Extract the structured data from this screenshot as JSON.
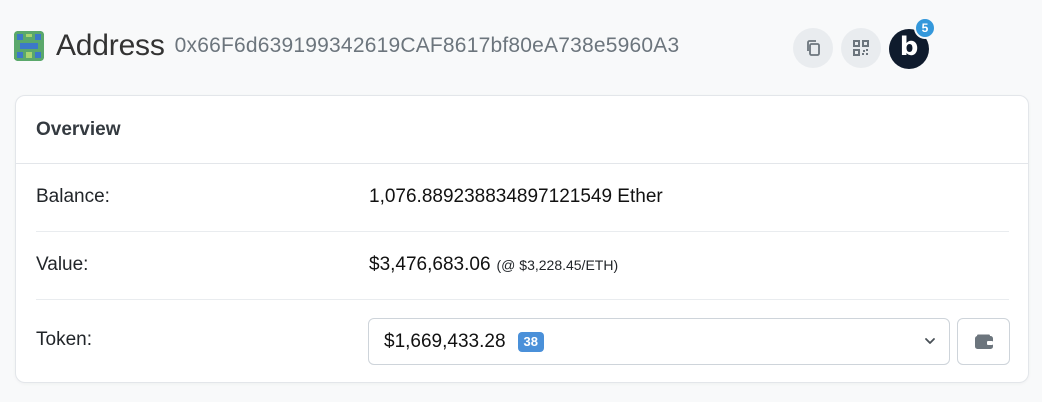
{
  "header": {
    "title": "Address",
    "address": "0x66F6d639199342619CAF8617bf80eA738e5960A3",
    "icons": {
      "copy": "copy-icon",
      "qr": "qr-code-icon",
      "blockscan": "blockscan-icon"
    },
    "blockscan_label": "b",
    "notification_count": "5"
  },
  "overview": {
    "title": "Overview",
    "balance": {
      "label": "Balance:",
      "value": "1,076.889238834897121549 Ether"
    },
    "value": {
      "label": "Value:",
      "amount": "$3,476,683.06",
      "rate": "(@ $3,228.45/ETH)"
    },
    "token": {
      "label": "Token:",
      "amount": "$1,669,433.28",
      "count": "38",
      "wallet_icon": "wallet-icon"
    }
  },
  "colors": {
    "accent": "#3498db",
    "badge": "#4a90d9",
    "blockscan_bg": "#0f1b2d",
    "page_bg": "#f8f9fa"
  }
}
